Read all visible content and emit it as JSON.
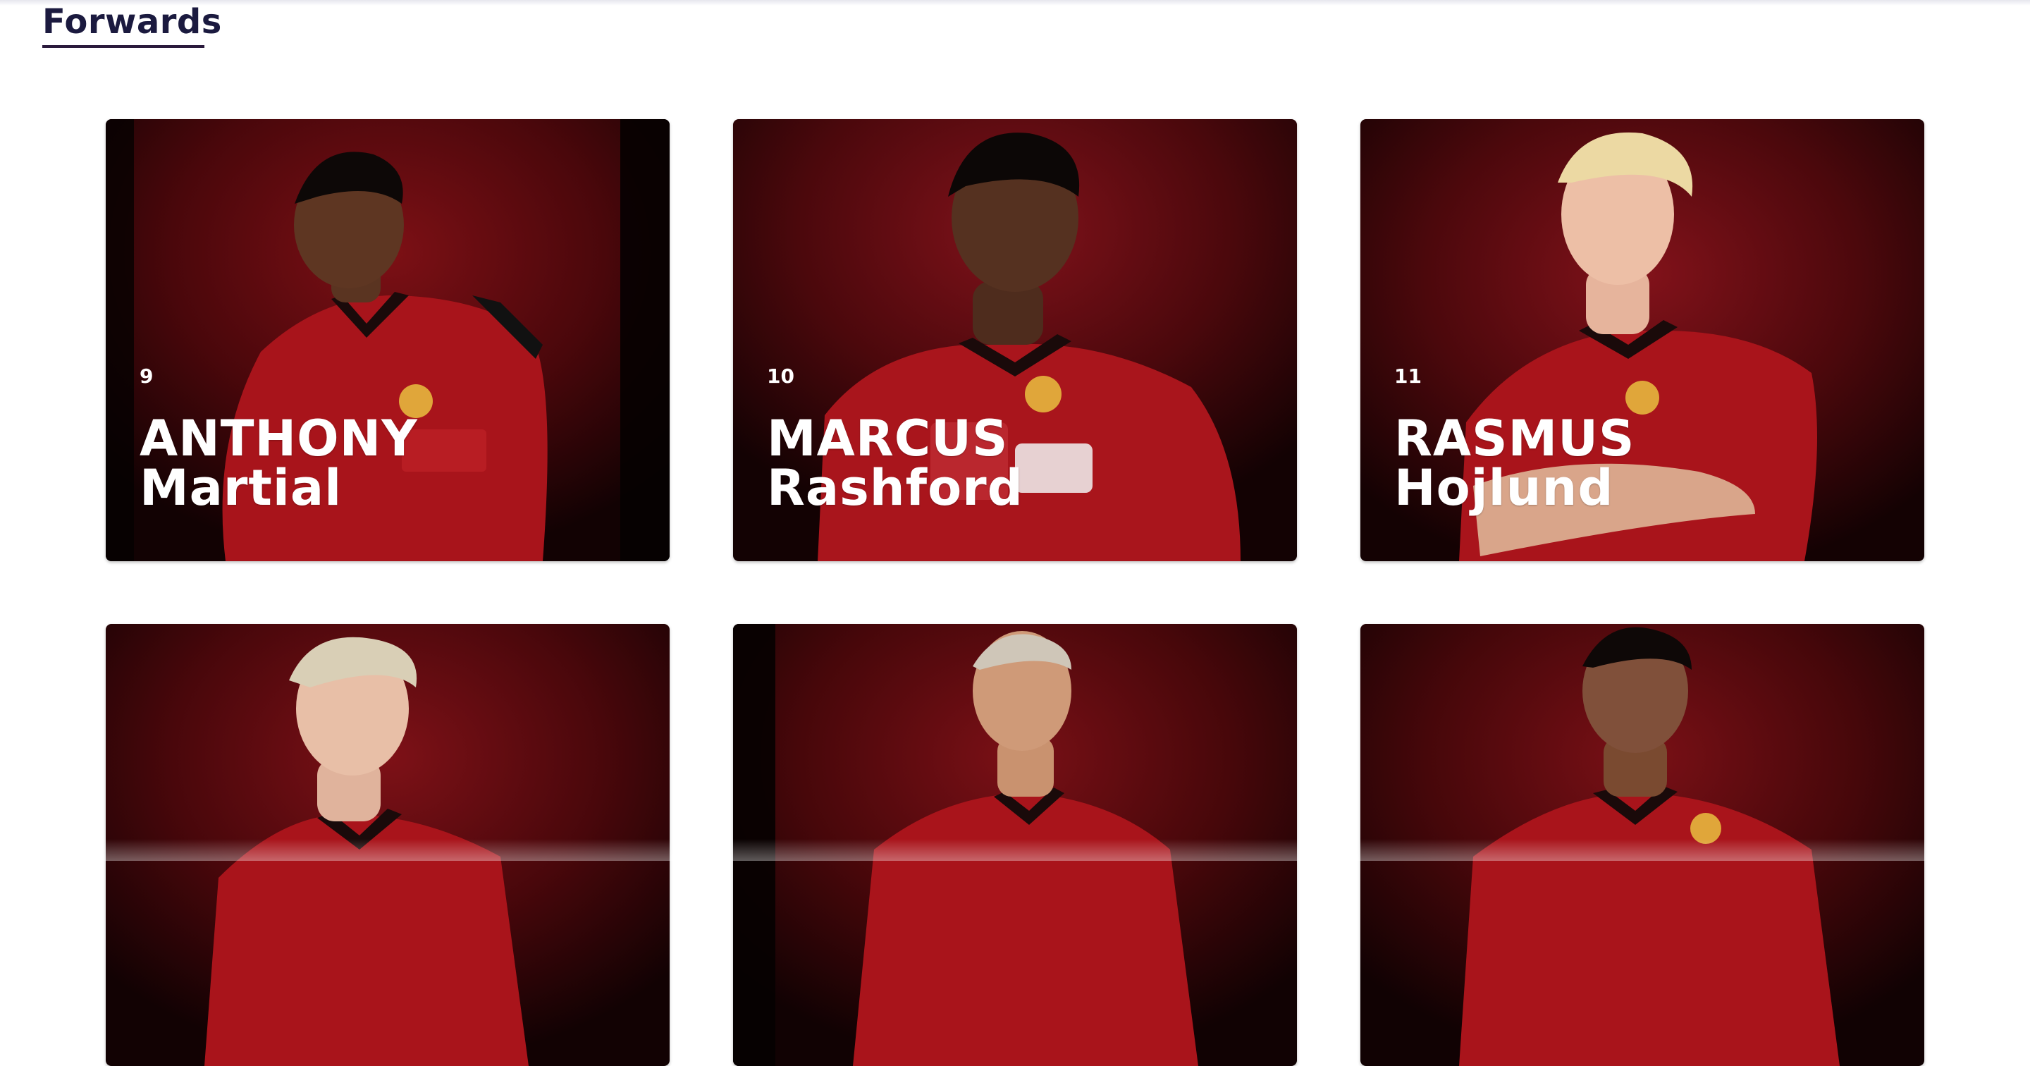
{
  "section": {
    "title": "Forwards"
  },
  "players": [
    {
      "number": "9",
      "first_name": "ANTHONY",
      "last_name": "Martial"
    },
    {
      "number": "10",
      "first_name": "MARCUS",
      "last_name": "Rashford"
    },
    {
      "number": "11",
      "first_name": "RASMUS",
      "last_name": "Hojlund"
    },
    {
      "number": "",
      "first_name": "",
      "last_name": ""
    },
    {
      "number": "",
      "first_name": "",
      "last_name": ""
    },
    {
      "number": "",
      "first_name": "",
      "last_name": ""
    }
  ],
  "colors": {
    "heading": "#1b1a3f",
    "card_background_dark": "#1a0305",
    "card_background_red": "#7a0d12",
    "kit_red": "#b0141b",
    "text_on_card": "#ffffff"
  }
}
